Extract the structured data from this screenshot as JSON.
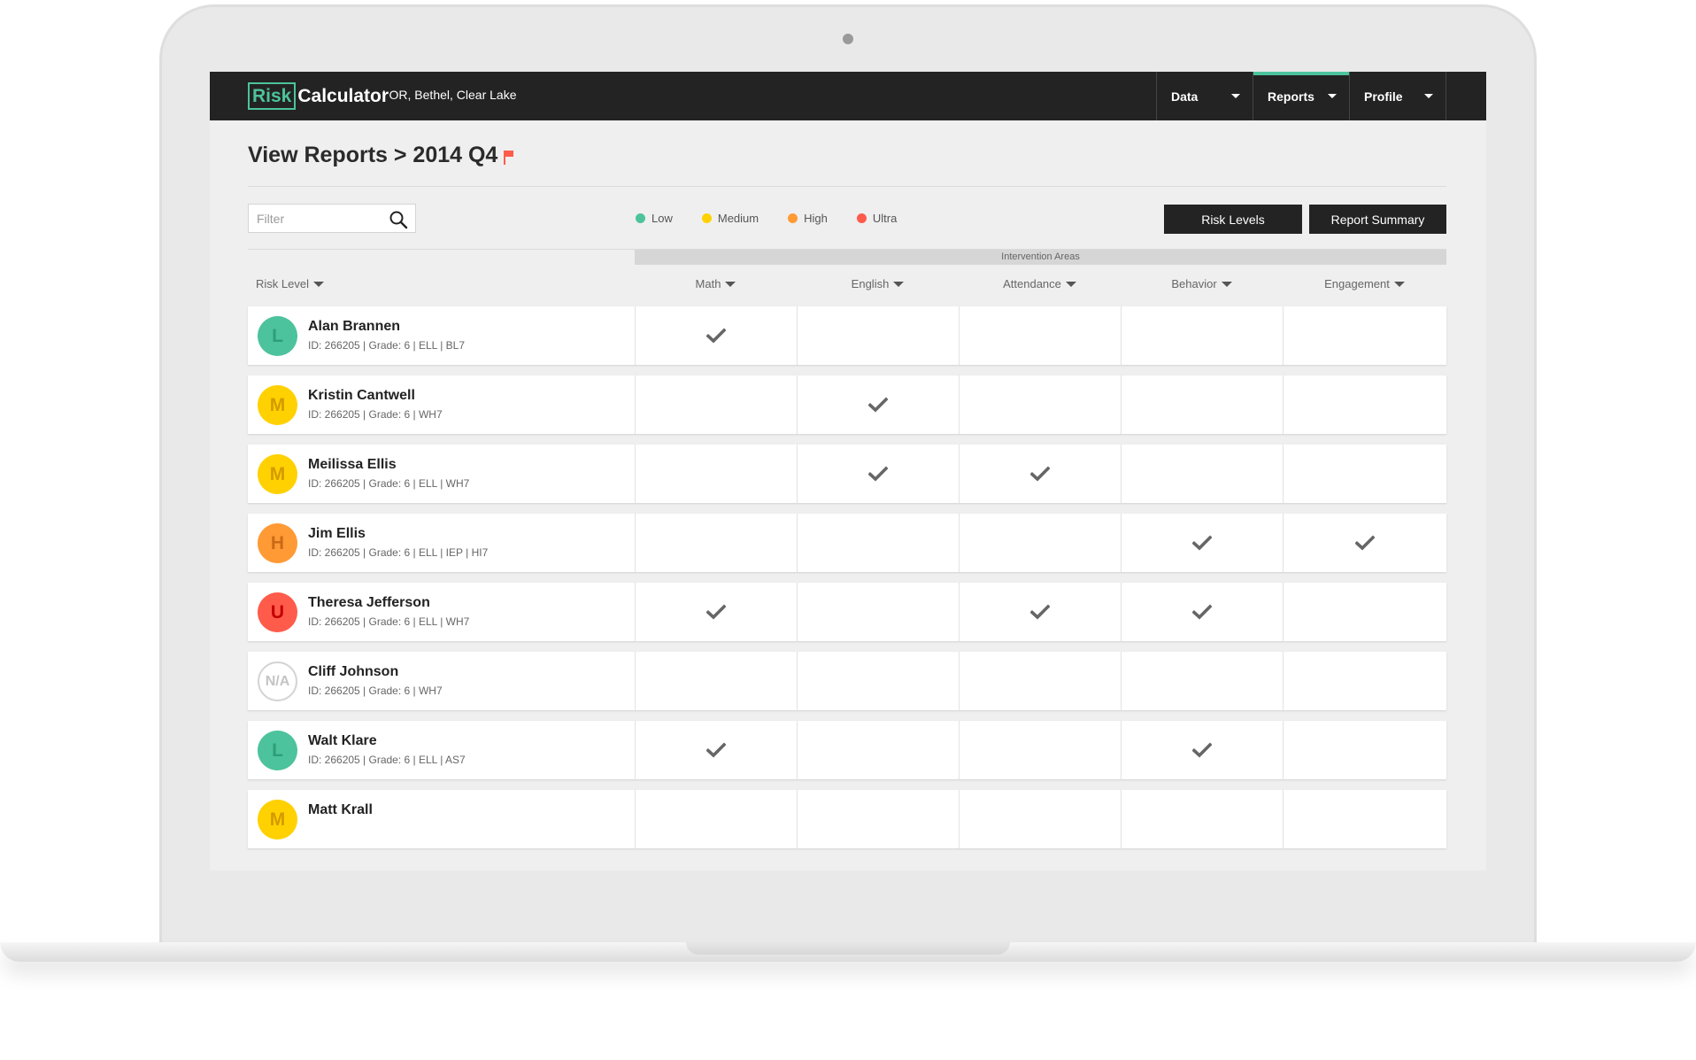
{
  "app": {
    "logo_part1": "Risk",
    "logo_part2": "Calculator",
    "location": "|  OR, Bethel, Clear Lake"
  },
  "nav": [
    {
      "label": "Data",
      "active": false
    },
    {
      "label": "Reports",
      "active": true
    },
    {
      "label": "Profile",
      "active": false
    }
  ],
  "page": {
    "title": "View Reports > 2014 Q4"
  },
  "filter": {
    "placeholder": "Filter"
  },
  "legend": [
    {
      "label": "Low",
      "color": "#4cc39c"
    },
    {
      "label": "Medium",
      "color": "#ffd100"
    },
    {
      "label": "High",
      "color": "#ff9a35"
    },
    {
      "label": "Ultra",
      "color": "#ff5b4b"
    }
  ],
  "buttons": {
    "risk_levels": "Risk Levels",
    "report_summary": "Report Summary"
  },
  "table": {
    "group_header": "Intervention Areas",
    "risk_level_header": "Risk Level",
    "columns": [
      "Math",
      "English",
      "Attendance",
      "Behavior",
      "Engagement"
    ],
    "rows": [
      {
        "initial": "L",
        "level": "L",
        "name": "Alan Brannen",
        "meta": "ID: 266205  |  Grade: 6  |  ELL  |  BL7",
        "checks": [
          true,
          false,
          false,
          false,
          false
        ]
      },
      {
        "initial": "M",
        "level": "M",
        "name": "Kristin Cantwell",
        "meta": "ID: 266205  |  Grade: 6  |  WH7",
        "checks": [
          false,
          true,
          false,
          false,
          false
        ]
      },
      {
        "initial": "M",
        "level": "M",
        "name": "Meilissa Ellis",
        "meta": "ID: 266205  |  Grade: 6  |  ELL  |  WH7",
        "checks": [
          false,
          true,
          true,
          false,
          false
        ]
      },
      {
        "initial": "H",
        "level": "H",
        "name": "Jim Ellis",
        "meta": "ID: 266205  |  Grade: 6  |  ELL  |  IEP  |  HI7",
        "checks": [
          false,
          false,
          false,
          true,
          true
        ]
      },
      {
        "initial": "U",
        "level": "U",
        "name": "Theresa Jefferson",
        "meta": "ID: 266205  |  Grade: 6  |  ELL  |  WH7",
        "checks": [
          true,
          false,
          true,
          true,
          false
        ]
      },
      {
        "initial": "N/A",
        "level": "N",
        "name": "Cliff Johnson",
        "meta": "ID: 266205  |  Grade: 6  |  WH7",
        "checks": [
          false,
          false,
          false,
          false,
          false
        ]
      },
      {
        "initial": "L",
        "level": "L",
        "name": "Walt Klare",
        "meta": "ID: 266205  |  Grade: 6  |  ELL  |  AS7",
        "checks": [
          true,
          false,
          false,
          true,
          false
        ]
      },
      {
        "initial": "M",
        "level": "M",
        "name": "Matt Krall",
        "meta": "",
        "checks": [
          false,
          false,
          false,
          false,
          false
        ]
      }
    ]
  }
}
